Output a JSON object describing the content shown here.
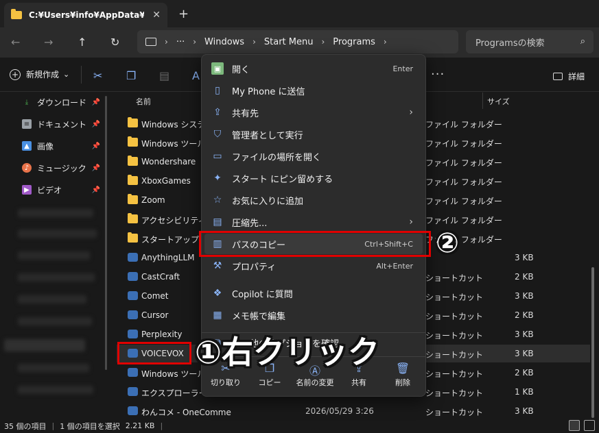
{
  "window": {
    "tab_title": "C:¥Users¥info¥AppData¥Roaming",
    "new_tab_symbol": "+",
    "tab_close_symbol": "✕"
  },
  "address": {
    "more": "···",
    "crumbs": [
      "Windows",
      "Start Menu",
      "Programs"
    ],
    "search_placeholder": "Programsの検索"
  },
  "toolbar": {
    "new_label": "新規作成",
    "new_arrow": "⌄",
    "more_symbol": "···",
    "details_label": "詳細"
  },
  "sidebar": {
    "items": [
      {
        "label": "ダウンロード",
        "icon": "download-icon",
        "color": "#4caf50"
      },
      {
        "label": "ドキュメント",
        "icon": "document-icon",
        "color": "#9aa0a6"
      },
      {
        "label": "画像",
        "icon": "picture-icon",
        "color": "#4a90e2"
      },
      {
        "label": "ミュージック",
        "icon": "music-icon",
        "color": "#e8734a"
      },
      {
        "label": "ビデオ",
        "icon": "video-icon",
        "color": "#a05ac8"
      }
    ]
  },
  "filelist": {
    "columns": {
      "name": "名前",
      "size": "サイズ"
    },
    "rows": [
      {
        "name": "Windows システム",
        "date": "",
        "type": "ファイル フォルダー",
        "size": "",
        "kind": "folder"
      },
      {
        "name": "Windows ツール",
        "date": "",
        "type": "ファイル フォルダー",
        "size": "",
        "kind": "folder"
      },
      {
        "name": "Wondershare",
        "date": "",
        "type": "ファイル フォルダー",
        "size": "",
        "kind": "folder"
      },
      {
        "name": "XboxGames",
        "date": "",
        "type": "ファイル フォルダー",
        "size": "",
        "kind": "folder"
      },
      {
        "name": "Zoom",
        "date": "",
        "type": "ファイル フォルダー",
        "size": "",
        "kind": "folder"
      },
      {
        "name": "アクセシビリティ",
        "date": "",
        "type": "ファイル フォルダー",
        "size": "",
        "kind": "folder"
      },
      {
        "name": "スタートアップ",
        "date": "",
        "type": "ファイル フォルダー",
        "size": "",
        "kind": "folder"
      },
      {
        "name": "AnythingLLM",
        "date": "",
        "type": "",
        "size": "3 KB",
        "kind": "shortcut"
      },
      {
        "name": "CastCraft",
        "date": "",
        "type": "ショートカット",
        "size": "2 KB",
        "kind": "shortcut"
      },
      {
        "name": "Comet",
        "date": "",
        "type": "ショートカット",
        "size": "3 KB",
        "kind": "shortcut"
      },
      {
        "name": "Cursor",
        "date": "",
        "type": "ショートカット",
        "size": "2 KB",
        "kind": "shortcut"
      },
      {
        "name": "Perplexity",
        "date": "",
        "type": "ショートカット",
        "size": "3 KB",
        "kind": "shortcut"
      },
      {
        "name": "VOICEVOX",
        "date": "",
        "type": "ショートカット",
        "size": "3 KB",
        "kind": "shortcut"
      },
      {
        "name": "Windows ツール",
        "date": "",
        "type": "ショートカット",
        "size": "2 KB",
        "kind": "shortcut"
      },
      {
        "name": "エクスプローラー",
        "date": "",
        "type": "ショートカット",
        "size": "1 KB",
        "kind": "shortcut"
      },
      {
        "name": "わんコメ - OneComme",
        "date": "2026/05/29 3:26",
        "type": "ショートカット",
        "size": "3 KB",
        "kind": "shortcut"
      }
    ]
  },
  "status": {
    "count": "35 個の項目",
    "selection": "1 個の項目を選択",
    "size": "2.21 KB"
  },
  "context_menu": {
    "items": [
      {
        "label": "開く",
        "shortcut": "Enter",
        "icon": "open-icon"
      },
      {
        "label": "My Phone に送信",
        "shortcut": "",
        "icon": "phone-icon"
      },
      {
        "label": "共有先",
        "shortcut": "",
        "icon": "share-icon",
        "submenu": true
      },
      {
        "label": "管理者として実行",
        "shortcut": "",
        "icon": "shield-icon"
      },
      {
        "label": "ファイルの場所を開く",
        "shortcut": "",
        "icon": "folder-open-icon"
      },
      {
        "label": "スタート にピン留めする",
        "shortcut": "",
        "icon": "pin-icon"
      },
      {
        "label": "お気に入りに追加",
        "shortcut": "",
        "icon": "star-icon"
      },
      {
        "label": "圧縮先...",
        "shortcut": "",
        "icon": "zip-icon",
        "submenu": true
      },
      {
        "label": "パスのコピー",
        "shortcut": "Ctrl+Shift+C",
        "icon": "copy-path-icon"
      },
      {
        "label": "プロパティ",
        "shortcut": "Alt+Enter",
        "icon": "wrench-icon"
      },
      {
        "label": "Copilot に質問",
        "shortcut": "",
        "icon": "copilot-icon"
      },
      {
        "label": "メモ帳で編集",
        "shortcut": "",
        "icon": "notepad-icon"
      },
      {
        "label": "その他のオプションを確認",
        "shortcut": "",
        "icon": "more-options-icon"
      }
    ],
    "quick_actions": [
      {
        "label": "切り取り",
        "icon": "cut-icon"
      },
      {
        "label": "コピー",
        "icon": "copy-icon"
      },
      {
        "label": "名前の変更",
        "icon": "rename-icon"
      },
      {
        "label": "共有",
        "icon": "share-icon"
      },
      {
        "label": "削除",
        "icon": "trash-icon"
      }
    ]
  },
  "annotations": {
    "step1": "①右クリック",
    "step2": "②",
    "color": "#e00000"
  }
}
